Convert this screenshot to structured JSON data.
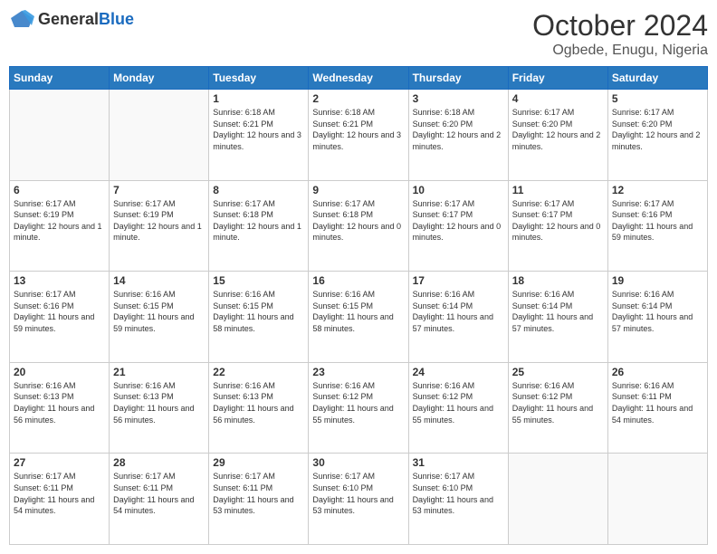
{
  "header": {
    "logo": {
      "general": "General",
      "blue": "Blue"
    },
    "title": "October 2024",
    "location": "Ogbede, Enugu, Nigeria"
  },
  "weekdays": [
    "Sunday",
    "Monday",
    "Tuesday",
    "Wednesday",
    "Thursday",
    "Friday",
    "Saturday"
  ],
  "weeks": [
    [
      {
        "day": "",
        "info": ""
      },
      {
        "day": "",
        "info": ""
      },
      {
        "day": "1",
        "info": "Sunrise: 6:18 AM\nSunset: 6:21 PM\nDaylight: 12 hours and 3 minutes."
      },
      {
        "day": "2",
        "info": "Sunrise: 6:18 AM\nSunset: 6:21 PM\nDaylight: 12 hours and 3 minutes."
      },
      {
        "day": "3",
        "info": "Sunrise: 6:18 AM\nSunset: 6:20 PM\nDaylight: 12 hours and 2 minutes."
      },
      {
        "day": "4",
        "info": "Sunrise: 6:17 AM\nSunset: 6:20 PM\nDaylight: 12 hours and 2 minutes."
      },
      {
        "day": "5",
        "info": "Sunrise: 6:17 AM\nSunset: 6:20 PM\nDaylight: 12 hours and 2 minutes."
      }
    ],
    [
      {
        "day": "6",
        "info": "Sunrise: 6:17 AM\nSunset: 6:19 PM\nDaylight: 12 hours and 1 minute."
      },
      {
        "day": "7",
        "info": "Sunrise: 6:17 AM\nSunset: 6:19 PM\nDaylight: 12 hours and 1 minute."
      },
      {
        "day": "8",
        "info": "Sunrise: 6:17 AM\nSunset: 6:18 PM\nDaylight: 12 hours and 1 minute."
      },
      {
        "day": "9",
        "info": "Sunrise: 6:17 AM\nSunset: 6:18 PM\nDaylight: 12 hours and 0 minutes."
      },
      {
        "day": "10",
        "info": "Sunrise: 6:17 AM\nSunset: 6:17 PM\nDaylight: 12 hours and 0 minutes."
      },
      {
        "day": "11",
        "info": "Sunrise: 6:17 AM\nSunset: 6:17 PM\nDaylight: 12 hours and 0 minutes."
      },
      {
        "day": "12",
        "info": "Sunrise: 6:17 AM\nSunset: 6:16 PM\nDaylight: 11 hours and 59 minutes."
      }
    ],
    [
      {
        "day": "13",
        "info": "Sunrise: 6:17 AM\nSunset: 6:16 PM\nDaylight: 11 hours and 59 minutes."
      },
      {
        "day": "14",
        "info": "Sunrise: 6:16 AM\nSunset: 6:15 PM\nDaylight: 11 hours and 59 minutes."
      },
      {
        "day": "15",
        "info": "Sunrise: 6:16 AM\nSunset: 6:15 PM\nDaylight: 11 hours and 58 minutes."
      },
      {
        "day": "16",
        "info": "Sunrise: 6:16 AM\nSunset: 6:15 PM\nDaylight: 11 hours and 58 minutes."
      },
      {
        "day": "17",
        "info": "Sunrise: 6:16 AM\nSunset: 6:14 PM\nDaylight: 11 hours and 57 minutes."
      },
      {
        "day": "18",
        "info": "Sunrise: 6:16 AM\nSunset: 6:14 PM\nDaylight: 11 hours and 57 minutes."
      },
      {
        "day": "19",
        "info": "Sunrise: 6:16 AM\nSunset: 6:14 PM\nDaylight: 11 hours and 57 minutes."
      }
    ],
    [
      {
        "day": "20",
        "info": "Sunrise: 6:16 AM\nSunset: 6:13 PM\nDaylight: 11 hours and 56 minutes."
      },
      {
        "day": "21",
        "info": "Sunrise: 6:16 AM\nSunset: 6:13 PM\nDaylight: 11 hours and 56 minutes."
      },
      {
        "day": "22",
        "info": "Sunrise: 6:16 AM\nSunset: 6:13 PM\nDaylight: 11 hours and 56 minutes."
      },
      {
        "day": "23",
        "info": "Sunrise: 6:16 AM\nSunset: 6:12 PM\nDaylight: 11 hours and 55 minutes."
      },
      {
        "day": "24",
        "info": "Sunrise: 6:16 AM\nSunset: 6:12 PM\nDaylight: 11 hours and 55 minutes."
      },
      {
        "day": "25",
        "info": "Sunrise: 6:16 AM\nSunset: 6:12 PM\nDaylight: 11 hours and 55 minutes."
      },
      {
        "day": "26",
        "info": "Sunrise: 6:16 AM\nSunset: 6:11 PM\nDaylight: 11 hours and 54 minutes."
      }
    ],
    [
      {
        "day": "27",
        "info": "Sunrise: 6:17 AM\nSunset: 6:11 PM\nDaylight: 11 hours and 54 minutes."
      },
      {
        "day": "28",
        "info": "Sunrise: 6:17 AM\nSunset: 6:11 PM\nDaylight: 11 hours and 54 minutes."
      },
      {
        "day": "29",
        "info": "Sunrise: 6:17 AM\nSunset: 6:11 PM\nDaylight: 11 hours and 53 minutes."
      },
      {
        "day": "30",
        "info": "Sunrise: 6:17 AM\nSunset: 6:10 PM\nDaylight: 11 hours and 53 minutes."
      },
      {
        "day": "31",
        "info": "Sunrise: 6:17 AM\nSunset: 6:10 PM\nDaylight: 11 hours and 53 minutes."
      },
      {
        "day": "",
        "info": ""
      },
      {
        "day": "",
        "info": ""
      }
    ]
  ]
}
